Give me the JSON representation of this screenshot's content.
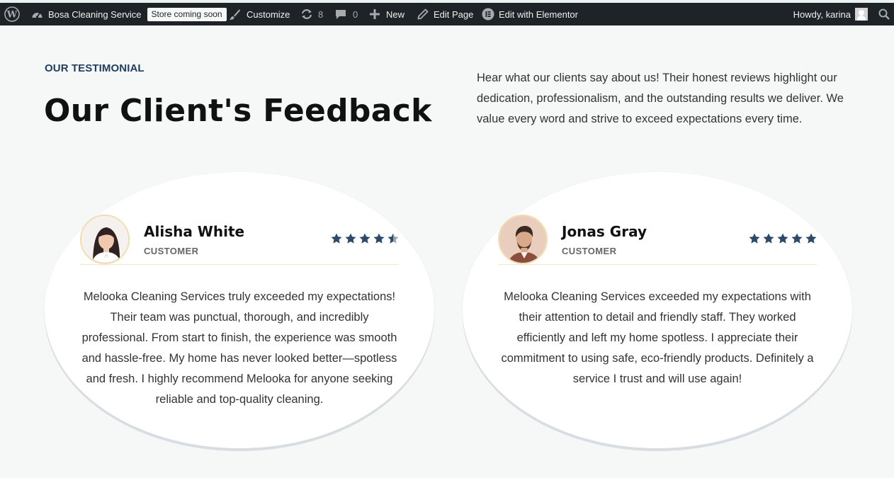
{
  "adminbar": {
    "site_name": "Bosa Cleaning Service",
    "store_badge": "Store coming soon",
    "customize": "Customize",
    "updates_count": "8",
    "comments_count": "0",
    "new_label": "New",
    "edit_page": "Edit Page",
    "edit_elementor": "Edit with Elementor",
    "howdy": "Howdy, karina"
  },
  "section": {
    "eyebrow": "OUR TESTIMONIAL",
    "heading": "Our Client's Feedback",
    "intro": "Hear what our clients say about us! Their honest reviews highlight our dedication, professionalism, and the outstanding results we deliver. We value every word and strive to exceed expectations every time."
  },
  "testimonials": [
    {
      "name": "Alisha White",
      "role": "CUSTOMER",
      "rating": 4.5,
      "quote": "Melooka Cleaning Services truly exceeded my expectations! Their team was punctual, thorough, and incredibly professional. From start to finish, the experience was smooth and hassle-free. My home has never looked better—spotless and fresh. I highly recommend Melooka for anyone seeking reliable and top-quality cleaning."
    },
    {
      "name": "Jonas Gray",
      "role": "CUSTOMER",
      "rating": 5,
      "quote": "Melooka Cleaning Services exceeded my expectations with their attention to detail and friendly staff. They worked efficiently and left my home spotless. I appreciate their commitment to using safe, eco-friendly products. Definitely a service I trust and will use again!"
    }
  ],
  "colors": {
    "adminbar_bg": "#1d2327",
    "accent_navy": "#203f5c",
    "star": "#2c4a6a",
    "star_empty": "#9aa3ab",
    "page_bg": "#f6f7f7"
  }
}
